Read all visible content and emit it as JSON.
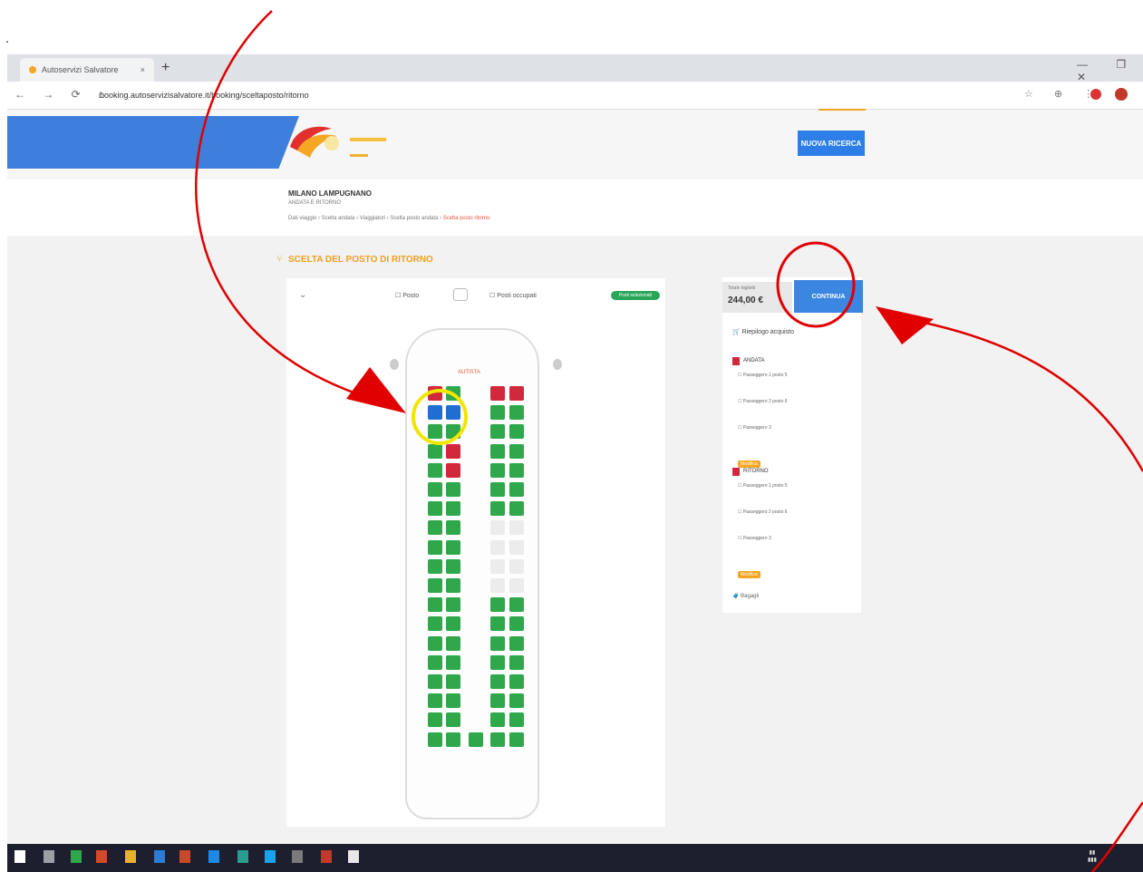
{
  "marker": ".",
  "browser": {
    "tab_title": "Autoservizi Salvatore",
    "new_tab": "+",
    "url": "booking.autoservizisalvatore.it/booking/sceltaposto/ritorno",
    "nav_icons": "← → ⟳ ⌂",
    "window_controls": "— ❐ ✕"
  },
  "header": {
    "new_search_label": "NUOVA RICERCA"
  },
  "trip": {
    "route": "MILANO LAMPUGNANO",
    "route_sub": "ANDATA E RITORNO",
    "breadcrumbs": [
      "Dati viaggio",
      "Scelta andata",
      "Viaggiatori",
      "Scelta posto andata",
      "Scelta posto ritorno"
    ],
    "section_title": "SCELTA DEL POSTO DI RITORNO"
  },
  "toolbar": {
    "items": [
      "Posto",
      "Posti occupati"
    ],
    "status_pill": "Posti selezionati"
  },
  "bus": {
    "driver_label": "AUTISTA"
  },
  "summary": {
    "price_label": "Totale biglietti",
    "price": "244,00 €",
    "continue_label": "CONTINUA",
    "heading": "Riepilogo acquisto",
    "legs": [
      {
        "title": "ANDATA",
        "passengers": [
          "Passeggero 1 posto 5",
          "Passeggero 2 posto 6",
          "Passeggero 3"
        ],
        "badge": "Modifica"
      },
      {
        "title": "RITORNO",
        "passengers": [
          "Passeggero 1 posto 5",
          "Passeggero 2 posto 6",
          "Passeggero 3"
        ],
        "badge": "Modifica"
      }
    ],
    "footnote": "Bagagli"
  },
  "colors": {
    "free_seat": "#2ea84a",
    "occupied_seat": "#d2283b",
    "selected_seat": "#1f6fd1",
    "primary": "#3b86e0",
    "annotation_red": "#e00000",
    "annotation_yellow": "#f2e600"
  }
}
